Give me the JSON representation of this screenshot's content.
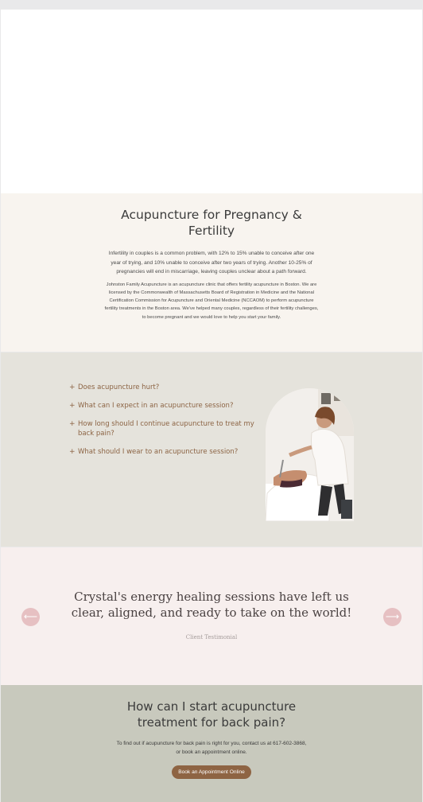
{
  "intro": {
    "title": "Acupuncture for Pregnancy & Fertility",
    "paragraph1": "Infertility in couples is a common problem, with 12% to 15% unable to conceive after one year of trying, and 10% unable to conceive after two years of trying. Another 10-25% of pregnancies will end in miscarriage, leaving couples unclear about a path forward.",
    "paragraph2": "Johnston Family Acupuncture is an acupuncture clinic that offers fertility acupuncture in Boston. We are licensed by the Commonwealth of Massachusetts Board of Registration in Medicine and the National Certification Commission for Acupuncture and Oriental Medicine (NCCAOM) to perform acupuncture fertility treatments in the Boston area. We've helped many couples, regardless of their fertility challenges, to become pregnant and we would love to help you start your family."
  },
  "faq": {
    "toggle_icon": "+",
    "items": [
      {
        "question": "Does acupuncture hurt?"
      },
      {
        "question": "What can I expect in an acupuncture session?"
      },
      {
        "question": "How long should I continue acupuncture to treat my back pain?"
      },
      {
        "question": "What should I wear to an acupuncture session?"
      }
    ]
  },
  "testimonial": {
    "quote": "Crystal's energy healing sessions have left us clear, aligned, and ready to take on the world!",
    "attribution": "Client Testimonial",
    "prev_icon": "⟵",
    "next_icon": "⟶"
  },
  "cta": {
    "title": "How can I start acupuncture treatment for back pain?",
    "text": "To find out if acupuncture for back pain is right for you, contact us at 617-602-3868, or book an appointment online.",
    "button_label": "Book an Appointment Online"
  },
  "colors": {
    "intro_bg": "#f8f4ef",
    "faq_bg": "#e5e3dc",
    "accent_brown": "#8c6444",
    "testimonial_bg": "#f7efee",
    "arrow_pink": "#e6c0c2",
    "cta_bg": "#c8c9bd"
  }
}
